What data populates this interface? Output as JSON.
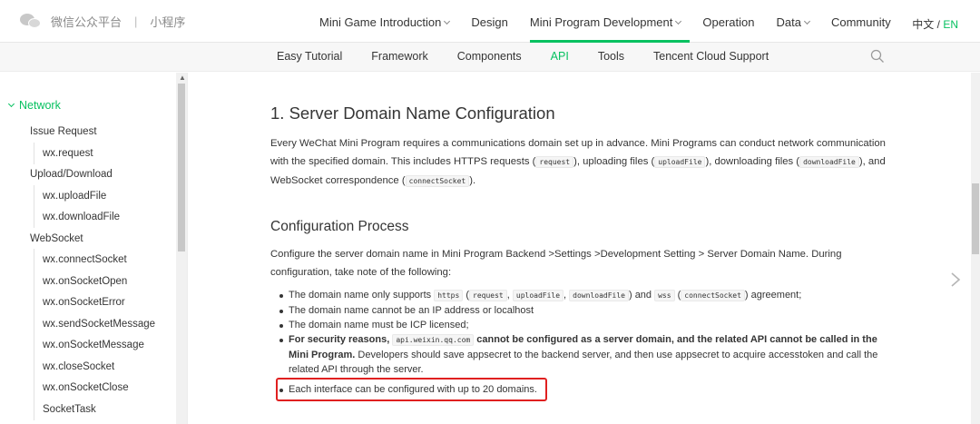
{
  "header": {
    "brand_name": "微信公众平台",
    "brand_separator": "|",
    "brand_section": "小程序",
    "nav": [
      {
        "label": "Mini Game Introduction",
        "dropdown": true
      },
      {
        "label": "Design",
        "dropdown": false
      },
      {
        "label": "Mini Program Development",
        "dropdown": true,
        "active": true
      },
      {
        "label": "Operation",
        "dropdown": false
      },
      {
        "label": "Data",
        "dropdown": true
      },
      {
        "label": "Community",
        "dropdown": false
      }
    ],
    "lang_zh": "中文",
    "lang_sep": " / ",
    "lang_en": "EN"
  },
  "subnav": {
    "items": [
      {
        "label": "Easy Tutorial"
      },
      {
        "label": "Framework"
      },
      {
        "label": "Components"
      },
      {
        "label": "API",
        "active": true
      },
      {
        "label": "Tools"
      },
      {
        "label": "Tencent Cloud Support"
      }
    ],
    "search_icon": "search-icon"
  },
  "sidebar": {
    "section": "Network",
    "items": [
      {
        "label": "Issue Request",
        "level": 1
      },
      {
        "label": "wx.request",
        "level": 2
      },
      {
        "label": "Upload/Download",
        "level": 1
      },
      {
        "label": "wx.uploadFile",
        "level": 2
      },
      {
        "label": "wx.downloadFile",
        "level": 2
      },
      {
        "label": "WebSocket",
        "level": 1
      },
      {
        "label": "wx.connectSocket",
        "level": 2
      },
      {
        "label": "wx.onSocketOpen",
        "level": 2
      },
      {
        "label": "wx.onSocketError",
        "level": 2
      },
      {
        "label": "wx.sendSocketMessage",
        "level": 2
      },
      {
        "label": "wx.onSocketMessage",
        "level": 2
      },
      {
        "label": "wx.closeSocket",
        "level": 2
      },
      {
        "label": "wx.onSocketClose",
        "level": 2
      },
      {
        "label": "SocketTask",
        "level": 2
      }
    ]
  },
  "content": {
    "title": "1. Server Domain Name Configuration",
    "intro": {
      "t1": "Every WeChat Mini Program requires a communications domain set up in advance. Mini Programs can conduct network communication with the specified domain. This includes HTTPS requests (",
      "c1": "request",
      "t2": "), uploading files (",
      "c2": "uploadFile",
      "t3": "), downloading files (",
      "c3": "downloadFile",
      "t4": "), and WebSocket correspondence (",
      "c4": "connectSocket",
      "t5": ")."
    },
    "subheading": "Configuration Process",
    "config_para": "Configure the server domain name in Mini Program Backend >Settings >Development Setting > Server Domain Name. During configuration, take note of the following:",
    "bullet1": {
      "t1": "The domain name only supports ",
      "c1": "https",
      "t2": " (",
      "c2": "request",
      "t3": ", ",
      "c3": "uploadFile",
      "t4": ", ",
      "c4": "downloadFile",
      "t5": ") and ",
      "c5": "wss",
      "t6": " (",
      "c6": "connectSocket",
      "t7": ") agreement;"
    },
    "bullet2": "The domain name cannot be an IP address or localhost",
    "bullet3": "The domain name must be ICP licensed;",
    "bullet4": {
      "b1": "For security reasons, ",
      "c1": "api.weixin.qq.com",
      "b2": " cannot be configured as a server domain, and the related API cannot be called in the Mini Program.",
      "t1": " Developers should save appsecret to the backend server, and then use appsecret to acquire accesstoken and call the related API through the server."
    },
    "bullet5": "Each interface can be configured with up to 20 domains.",
    "highlight_color": "#e02020"
  },
  "colors": {
    "accent": "#07c160",
    "text": "#353535"
  }
}
